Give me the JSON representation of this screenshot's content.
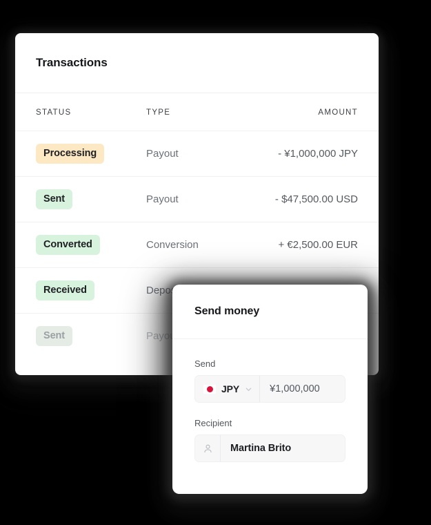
{
  "theme": {
    "background": "#000000",
    "card_bg": "#ffffff",
    "badge_amber": "#fce8c3",
    "badge_green": "#d7f2dd",
    "text_primary": "#16171a",
    "text_muted": "#6b7079",
    "field_bg": "#f7f7f8",
    "flag_red": "#d8123a"
  },
  "card": {
    "title": "Transactions",
    "table": {
      "columns": [
        "STATUS",
        "TYPE",
        "AMOUNT"
      ],
      "rows": [
        {
          "status": "Processing",
          "status_tone": "amber",
          "type": "Payout",
          "amount": "- ¥1,000,000 JPY"
        },
        {
          "status": "Sent",
          "status_tone": "green",
          "type": "Payout",
          "amount": "- $47,500.00 USD"
        },
        {
          "status": "Converted",
          "status_tone": "green",
          "type": "Conversion",
          "amount": "+ €2,500.00 EUR"
        },
        {
          "status": "Received",
          "status_tone": "green",
          "type": "Deposit",
          "amount": ""
        },
        {
          "status": "Sent",
          "status_tone": "green",
          "type": "Payout",
          "amount": ""
        }
      ]
    }
  },
  "popup": {
    "title": "Send money",
    "send": {
      "label": "Send",
      "currency_code": "JPY",
      "currency_flag": "flag-jp-icon",
      "chevron": "chevron-down-icon",
      "amount": "¥1,000,000"
    },
    "recipient": {
      "label": "Recipient",
      "icon": "person-icon",
      "name": "Martina Brito"
    }
  }
}
